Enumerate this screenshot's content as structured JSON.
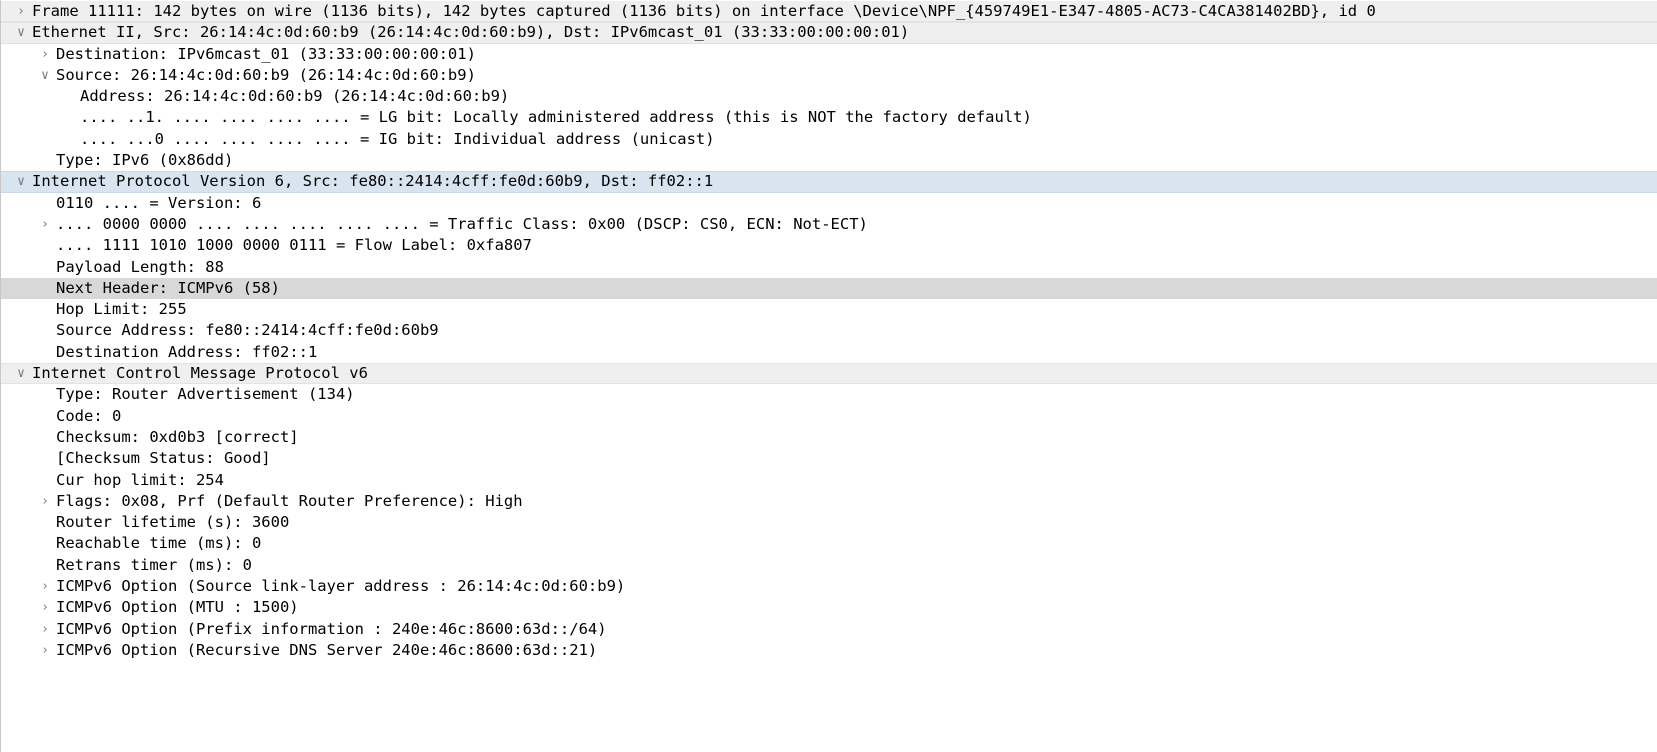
{
  "pane": {
    "name": "packet-details",
    "background": "#ffffff",
    "proto_row_bg": "#efefef",
    "focus_row_bg": "#d9e4f1",
    "selected_row_bg": "#d8d8d8",
    "text_color": "#000000",
    "expander_color": "#7a7a7a"
  },
  "icons": {
    "collapsed": "›",
    "expanded": "∨"
  },
  "rows": [
    {
      "id": "frame",
      "text": "Frame 11111: 142 bytes on wire (1136 bits), 142 bytes captured (1136 bits) on interface \\Device\\NPF_{459749E1-E347-4805-AC73-C4CA381402BD}, id 0",
      "indent": 0,
      "state": "collapsed",
      "style": "proto"
    },
    {
      "id": "ethernet-ii",
      "text": "Ethernet II, Src: 26:14:4c:0d:60:b9 (26:14:4c:0d:60:b9), Dst: IPv6mcast_01 (33:33:00:00:00:01)",
      "indent": 0,
      "state": "expanded",
      "style": "proto"
    },
    {
      "id": "eth-destination",
      "text": "Destination: IPv6mcast_01 (33:33:00:00:00:01)",
      "indent": 1,
      "state": "collapsed",
      "style": "plain"
    },
    {
      "id": "eth-source",
      "text": "Source: 26:14:4c:0d:60:b9 (26:14:4c:0d:60:b9)",
      "indent": 1,
      "state": "expanded",
      "style": "plain"
    },
    {
      "id": "eth-source-address",
      "text": "Address: 26:14:4c:0d:60:b9 (26:14:4c:0d:60:b9)",
      "indent": 2,
      "state": "leaf",
      "style": "plain"
    },
    {
      "id": "eth-lg-bit",
      "text": ".... ..1. .... .... .... .... = LG bit: Locally administered address (this is NOT the factory default)",
      "indent": 2,
      "state": "leaf",
      "style": "plain"
    },
    {
      "id": "eth-ig-bit",
      "text": ".... ...0 .... .... .... .... = IG bit: Individual address (unicast)",
      "indent": 2,
      "state": "leaf",
      "style": "plain"
    },
    {
      "id": "eth-type",
      "text": "Type: IPv6 (0x86dd)",
      "indent": 1,
      "state": "leaf",
      "style": "plain"
    },
    {
      "id": "ipv6",
      "text": "Internet Protocol Version 6, Src: fe80::2414:4cff:fe0d:60b9, Dst: ff02::1",
      "indent": 0,
      "state": "expanded",
      "style": "focus-proto"
    },
    {
      "id": "ipv6-version",
      "text": "0110 .... = Version: 6",
      "indent": 1,
      "state": "leaf",
      "style": "plain"
    },
    {
      "id": "ipv6-traffic-class",
      "text": ".... 0000 0000 .... .... .... .... .... = Traffic Class: 0x00 (DSCP: CS0, ECN: Not-ECT)",
      "indent": 1,
      "state": "collapsed",
      "style": "plain"
    },
    {
      "id": "ipv6-flow-label",
      "text": ".... 1111 1010 1000 0000 0111 = Flow Label: 0xfa807",
      "indent": 1,
      "state": "leaf",
      "style": "plain"
    },
    {
      "id": "ipv6-payload-length",
      "text": "Payload Length: 88",
      "indent": 1,
      "state": "leaf",
      "style": "plain"
    },
    {
      "id": "ipv6-next-header",
      "text": "Next Header: ICMPv6 (58)",
      "indent": 1,
      "state": "leaf",
      "style": "selected"
    },
    {
      "id": "ipv6-hop-limit",
      "text": "Hop Limit: 255",
      "indent": 1,
      "state": "leaf",
      "style": "plain"
    },
    {
      "id": "ipv6-source-address",
      "text": "Source Address: fe80::2414:4cff:fe0d:60b9",
      "indent": 1,
      "state": "leaf",
      "style": "plain"
    },
    {
      "id": "ipv6-destination-address",
      "text": "Destination Address: ff02::1",
      "indent": 1,
      "state": "leaf",
      "style": "plain"
    },
    {
      "id": "icmpv6",
      "text": "Internet Control Message Protocol v6",
      "indent": 0,
      "state": "expanded",
      "style": "proto"
    },
    {
      "id": "icmpv6-type",
      "text": "Type: Router Advertisement (134)",
      "indent": 1,
      "state": "leaf",
      "style": "plain"
    },
    {
      "id": "icmpv6-code",
      "text": "Code: 0",
      "indent": 1,
      "state": "leaf",
      "style": "plain"
    },
    {
      "id": "icmpv6-checksum",
      "text": "Checksum: 0xd0b3 [correct]",
      "indent": 1,
      "state": "leaf",
      "style": "plain"
    },
    {
      "id": "icmpv6-checksum-status",
      "text": "[Checksum Status: Good]",
      "indent": 1,
      "state": "leaf",
      "style": "plain"
    },
    {
      "id": "icmpv6-cur-hop-limit",
      "text": "Cur hop limit: 254",
      "indent": 1,
      "state": "leaf",
      "style": "plain"
    },
    {
      "id": "icmpv6-flags",
      "text": "Flags: 0x08, Prf (Default Router Preference): High",
      "indent": 1,
      "state": "collapsed",
      "style": "plain"
    },
    {
      "id": "icmpv6-router-lifetime",
      "text": "Router lifetime (s): 3600",
      "indent": 1,
      "state": "leaf",
      "style": "plain"
    },
    {
      "id": "icmpv6-reachable-time",
      "text": "Reachable time (ms): 0",
      "indent": 1,
      "state": "leaf",
      "style": "plain"
    },
    {
      "id": "icmpv6-retrans-timer",
      "text": "Retrans timer (ms): 0",
      "indent": 1,
      "state": "leaf",
      "style": "plain"
    },
    {
      "id": "icmpv6-option-source-linklayer",
      "text": "ICMPv6 Option (Source link-layer address : 26:14:4c:0d:60:b9)",
      "indent": 1,
      "state": "collapsed",
      "style": "plain"
    },
    {
      "id": "icmpv6-option-mtu",
      "text": "ICMPv6 Option (MTU : 1500)",
      "indent": 1,
      "state": "collapsed",
      "style": "plain"
    },
    {
      "id": "icmpv6-option-prefix-information",
      "text": "ICMPv6 Option (Prefix information : 240e:46c:8600:63d::/64)",
      "indent": 1,
      "state": "collapsed",
      "style": "plain"
    },
    {
      "id": "icmpv6-option-recursive-dns-server",
      "text": "ICMPv6 Option (Recursive DNS Server 240e:46c:8600:63d::21)",
      "indent": 1,
      "state": "collapsed",
      "style": "plain"
    }
  ]
}
